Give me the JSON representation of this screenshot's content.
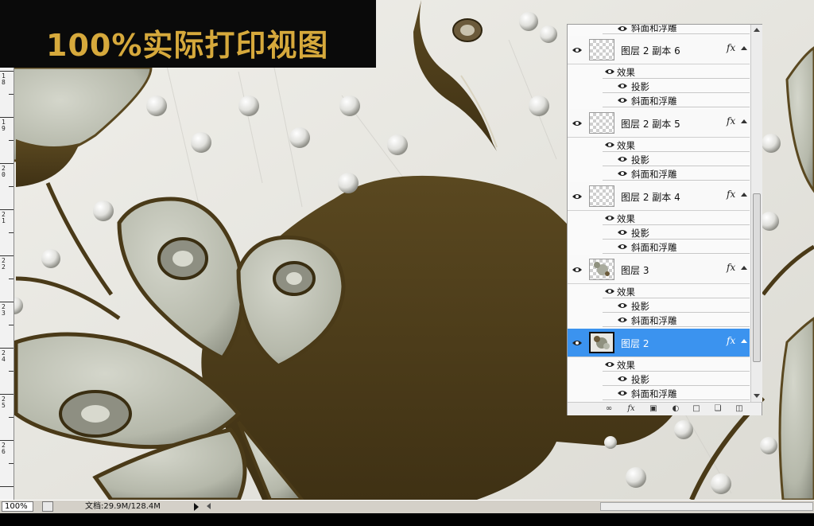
{
  "banner": {
    "title": "100%实际打印视图"
  },
  "ruler": {
    "labels": [
      "18",
      "19",
      "20",
      "21",
      "22",
      "23",
      "24",
      "25",
      "26"
    ]
  },
  "layers_panel": {
    "top_partial_effect": "斜面和浮雕",
    "layers": [
      {
        "name": "图层 2 副本 6",
        "fx": "fx",
        "selected": false,
        "effects_label": "效果",
        "effects": [
          "投影",
          "斜面和浮雕"
        ]
      },
      {
        "name": "图层 2 副本 5",
        "fx": "fx",
        "selected": false,
        "effects_label": "效果",
        "effects": [
          "投影",
          "斜面和浮雕"
        ]
      },
      {
        "name": "图层 2 副本 4",
        "fx": "fx",
        "selected": false,
        "effects_label": "效果",
        "effects": [
          "投影",
          "斜面和浮雕"
        ]
      },
      {
        "name": "图层 3",
        "fx": "fx",
        "selected": false,
        "effects_label": "效果",
        "effects": [
          "投影",
          "斜面和浮雕"
        ]
      },
      {
        "name": "图层 2",
        "fx": "fx",
        "selected": true,
        "effects_label": "效果",
        "effects": [
          "投影",
          "斜面和浮雕"
        ]
      }
    ],
    "footer_icons": [
      "link-icon",
      "fx-icon",
      "mask-icon",
      "adjustment-icon",
      "folder-icon",
      "new-layer-icon",
      "trash-icon"
    ]
  },
  "status_bar": {
    "zoom": "100%",
    "doc_info": "文档:29.9M/128.4M"
  },
  "colors": {
    "banner_bg": "#0a0a0a",
    "banner_text": "#d6a93c",
    "selected_layer": "#3b93ef",
    "relief_brown": "#4a3a18",
    "relief_gray": "#b7b9ac"
  }
}
